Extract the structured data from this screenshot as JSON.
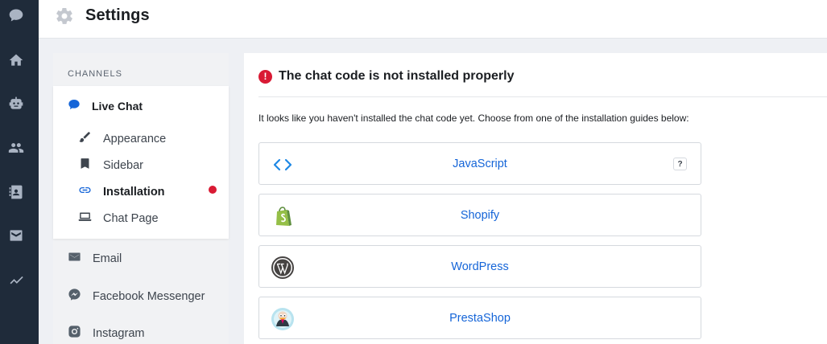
{
  "app": {
    "title": "Settings",
    "icon": "gear-icon"
  },
  "rail": {
    "items": [
      {
        "icon": "chat-bubble-icon"
      },
      {
        "icon": "home-icon"
      },
      {
        "icon": "bot-icon"
      },
      {
        "icon": "contacts-icon"
      },
      {
        "icon": "address-book-icon"
      },
      {
        "icon": "inbox-icon"
      },
      {
        "icon": "analytics-icon"
      }
    ]
  },
  "sidebar": {
    "section_label": "CHANNELS",
    "active_channel": {
      "label": "Live Chat",
      "icon": "chat-bubble-icon",
      "sub_items": [
        {
          "label": "Appearance",
          "icon": "brush-icon",
          "active": false
        },
        {
          "label": "Sidebar",
          "icon": "bookmark-icon",
          "active": false
        },
        {
          "label": "Installation",
          "icon": "link-icon",
          "active": true,
          "alert": true
        },
        {
          "label": "Chat Page",
          "icon": "laptop-icon",
          "active": false
        }
      ]
    },
    "channels": [
      {
        "label": "Email",
        "icon": "envelope-icon"
      },
      {
        "label": "Facebook Messenger",
        "icon": "messenger-icon"
      },
      {
        "label": "Instagram",
        "icon": "instagram-icon"
      }
    ]
  },
  "main": {
    "alert_title": "The chat code is not installed properly",
    "intro": "It looks like you haven't installed the chat code yet. Choose from one of the installation guides below:",
    "guides": [
      {
        "label": "JavaScript",
        "icon": "code-icon",
        "help": "?"
      },
      {
        "label": "Shopify",
        "icon": "shopify-icon"
      },
      {
        "label": "WordPress",
        "icon": "wordpress-icon"
      },
      {
        "label": "PrestaShop",
        "icon": "prestashop-icon"
      }
    ]
  },
  "colors": {
    "rail_bg": "#1f2b3a",
    "accent": "#1565d8",
    "alert": "#d91a34",
    "page_bg": "#eef0f4"
  }
}
